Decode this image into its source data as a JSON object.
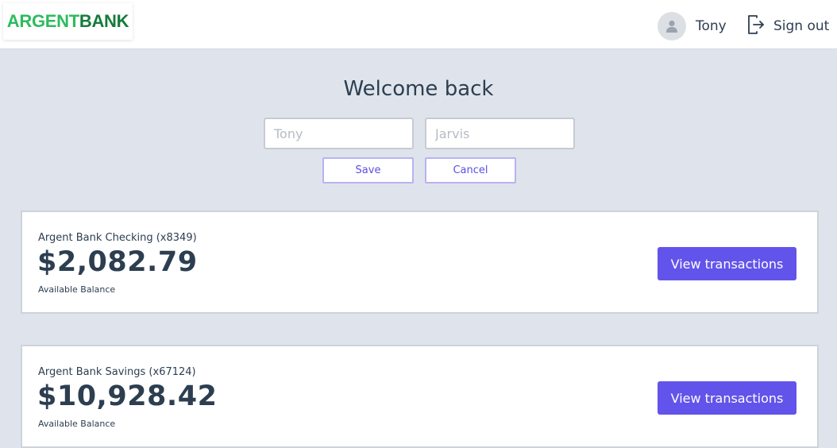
{
  "header": {
    "logo_part1": "ARGENT",
    "logo_part2": "BANK",
    "user_name": "Tony",
    "signout_label": "Sign out",
    "avatar_icon": "user-avatar-icon",
    "signout_icon": "sign-out-icon"
  },
  "profile": {
    "welcome": "Welcome back",
    "first_name_placeholder": "Tony",
    "last_name_placeholder": "Jarvis",
    "save_label": "Save",
    "cancel_label": "Cancel"
  },
  "accounts": [
    {
      "title": "Argent Bank Checking (x8349)",
      "amount": "$2,082.79",
      "description": "Available Balance",
      "button_label": "View transactions"
    },
    {
      "title": "Argent Bank Savings (x67124)",
      "amount": "$10,928.42",
      "description": "Available Balance",
      "button_label": "View transactions"
    }
  ],
  "colors": {
    "page_background": "#dfe4ec",
    "accent": "#6254ea",
    "logo_green_light": "#2dbb5f",
    "logo_green_dark": "#167a3a",
    "text": "#2c3e50"
  }
}
